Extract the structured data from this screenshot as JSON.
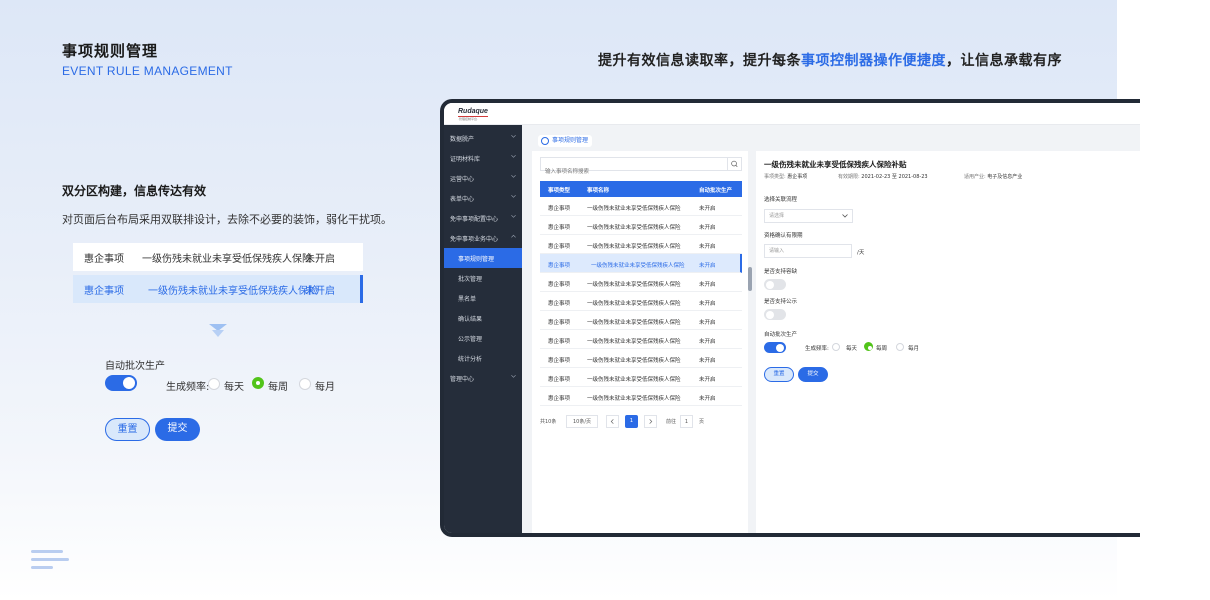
{
  "header": {
    "title": "事项规则管理",
    "subtitle": "EVENT RULE MANAGEMENT",
    "headline_pre": "提升有效信息读取率，提升每条",
    "headline_highlight": "事项控制器操作便捷度",
    "headline_post": "，让信息承载有序"
  },
  "section": {
    "title": "双分区构建，信息传达有效",
    "desc": "对页面后台布局采用双联排设计，去除不必要的装饰，弱化干扰项。"
  },
  "demo": {
    "rows": [
      {
        "type": "惠企事项",
        "name": "一级伤残未就业未享受低保残疾人保险",
        "status": "未开启"
      },
      {
        "type": "惠企事项",
        "name": "一级伤残未就业未享受低保残疾人保险",
        "status": "未开启"
      }
    ],
    "auto_label": "自动批次生产",
    "freq_label": "生成频率:",
    "opt_daily": "每天",
    "opt_weekly": "每周",
    "opt_monthly": "每月",
    "reset": "重置",
    "submit": "提交"
  },
  "app": {
    "logo": "Rudaque",
    "logo_tag": "·管理控制平台·",
    "nav": [
      {
        "label": "数据脱产"
      },
      {
        "label": "证明材料库"
      },
      {
        "label": "运营中心"
      },
      {
        "label": "表单中心"
      },
      {
        "label": "免申事项配置中心"
      },
      {
        "label": "免申事项业务中心"
      },
      {
        "label": "事项规则管理"
      },
      {
        "label": "批次管理"
      },
      {
        "label": "黑名单"
      },
      {
        "label": "确认结果"
      },
      {
        "label": "公示管理"
      },
      {
        "label": "统计分析"
      },
      {
        "label": "管理中心"
      }
    ],
    "tab": "事项规则管理",
    "search_placeholder": "输入事项名称搜索",
    "table": {
      "headers": [
        "事项类型",
        "事项名称",
        "自动批次生产"
      ],
      "rows": [
        [
          "惠企事项",
          "一级伤残未就业未享受低保残疾人保险",
          "未开启"
        ],
        [
          "惠企事项",
          "一级伤残未就业未享受低保残疾人保险",
          "未开启"
        ],
        [
          "惠企事项",
          "一级伤残未就业未享受低保残疾人保险",
          "未开启"
        ],
        [
          "惠企事项",
          "一级伤残未就业未享受低保残疾人保险",
          "未开启"
        ],
        [
          "惠企事项",
          "一级伤残未就业未享受低保残疾人保险",
          "未开启"
        ],
        [
          "惠企事项",
          "一级伤残未就业未享受低保残疾人保险",
          "未开启"
        ],
        [
          "惠企事项",
          "一级伤残未就业未享受低保残疾人保险",
          "未开启"
        ],
        [
          "惠企事项",
          "一级伤残未就业未享受低保残疾人保险",
          "未开启"
        ],
        [
          "惠企事项",
          "一级伤残未就业未享受低保残疾人保险",
          "未开启"
        ],
        [
          "惠企事项",
          "一级伤残未就业未享受低保残疾人保险",
          "未开启"
        ],
        [
          "惠企事项",
          "一级伤残未就业未享受低保残疾人保险",
          "未开启"
        ]
      ]
    },
    "pager": {
      "total": "共10条",
      "page_size": "10条/页",
      "current": "1",
      "goto": "前往",
      "goto_value": "1",
      "page_unit": "页"
    },
    "detail": {
      "title": "一级伤残未就业未享受低保残疾人保险补贴",
      "type_label": "事项类型:",
      "type_value": "惠企事项",
      "period_label": "有效期限:",
      "period_value": "2021-02-23 至 2021-08-23",
      "industry_label": "适用产业:",
      "industry_value": "电子及信息产业",
      "flow_label": "选择关联流程",
      "flow_placeholder": "请选择",
      "confirm_label": "资格确认有限期",
      "confirm_placeholder": "请输入",
      "confirm_unit": "/天",
      "appeal_label": "是否支持容缺",
      "public_label": "是否支持公示",
      "auto_label": "自动批次生产",
      "freq_label": "生成频率:",
      "opt_daily": "每天",
      "opt_weekly": "每周",
      "opt_monthly": "每月",
      "reset": "重置",
      "submit": "提交"
    }
  },
  "colors": {
    "accent": "#2b6be6",
    "sidebar": "#252d3a",
    "selected_radio": "#52c41a"
  }
}
